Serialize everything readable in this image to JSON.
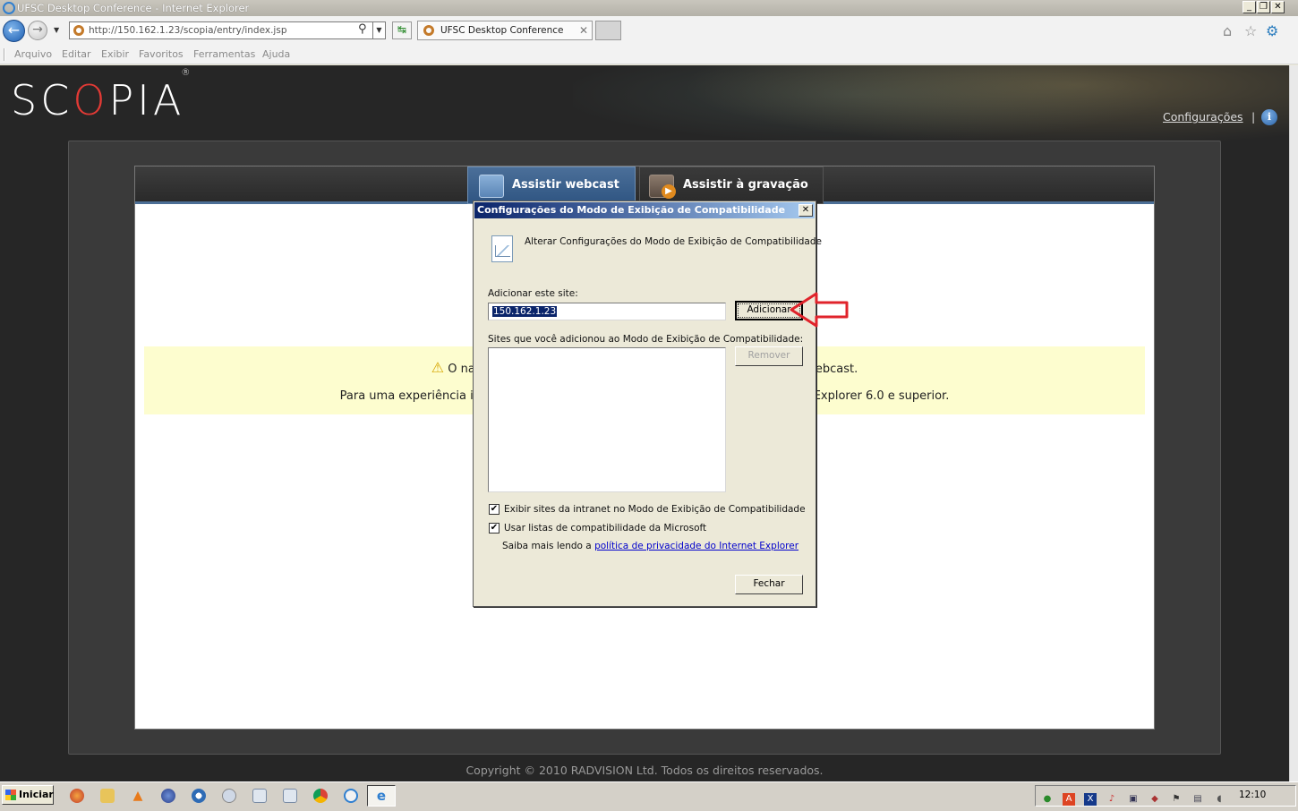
{
  "window": {
    "title": "UFSC Desktop Conference - Internet Explorer",
    "minimize": "_",
    "restore": "❐",
    "close": "✕"
  },
  "browser": {
    "back_icon": "←",
    "forward_icon": "→",
    "address_url": "http://150.162.1.23/scopia/entry/index.jsp",
    "tab_title": "UFSC Desktop Conference",
    "tab_close": "✕",
    "search_glyph": "⚲",
    "dropdown_glyph": "▼",
    "compat_glyph": "↹",
    "home_glyph": "⌂",
    "favorites_glyph": "☆",
    "tools_glyph": "⚙"
  },
  "menu": {
    "items": [
      "Arquivo",
      "Editar",
      "Exibir",
      "Favoritos",
      "Ferramentas",
      "Ajuda"
    ]
  },
  "page": {
    "logo_prefix": "SC",
    "logo_o": "O",
    "logo_suffix": "PIA",
    "logo_reg": "®",
    "config_link": "Configurações",
    "separator": "|",
    "info_glyph": "i",
    "tabs": [
      {
        "label": "Assistir webcast",
        "active": true
      },
      {
        "label": "Assistir à gravação",
        "active": false
      }
    ],
    "warning_icon": "⚠",
    "warning_line1": "O na",
    "warning_line1_end": "ebcast.",
    "warning_line2": "Para uma experiência i",
    "warning_line2_end": "Explorer 6.0 e superior.",
    "copyright": "Copyright © 2010 RADVISION Ltd. Todos os direitos reservados."
  },
  "dialog": {
    "title": "Configurações do Modo de Exibição de Compatibilidade",
    "close": "✕",
    "header_text": "Alterar Configurações do Modo de Exibição de Compatibilidade",
    "add_site_label": "Adicionar este site:",
    "site_value": "150.162.1.23",
    "add_button": "Adicionar",
    "list_label": "Sites que você adicionou ao Modo de Exibição de Compatibilidade:",
    "remove_button": "Remover",
    "checkbox_intranet": {
      "label": "Exibir sites da intranet no Modo de Exibição de Compatibilidade",
      "checked": true,
      "glyph": "✔"
    },
    "checkbox_microsoft": {
      "label": "Usar listas de compatibilidade da Microsoft",
      "checked": true,
      "glyph": "✔"
    },
    "privacy_prefix": "Saiba mais lendo a ",
    "privacy_link": "política de privacidade do Internet Explorer",
    "close_button": "Fechar"
  },
  "taskbar": {
    "start_label": "Iniciar",
    "clock": "12:10"
  },
  "colors": {
    "annotation_arrow": "#e0232b",
    "page_bg": "#262626",
    "tab_active": "#3d6594"
  }
}
